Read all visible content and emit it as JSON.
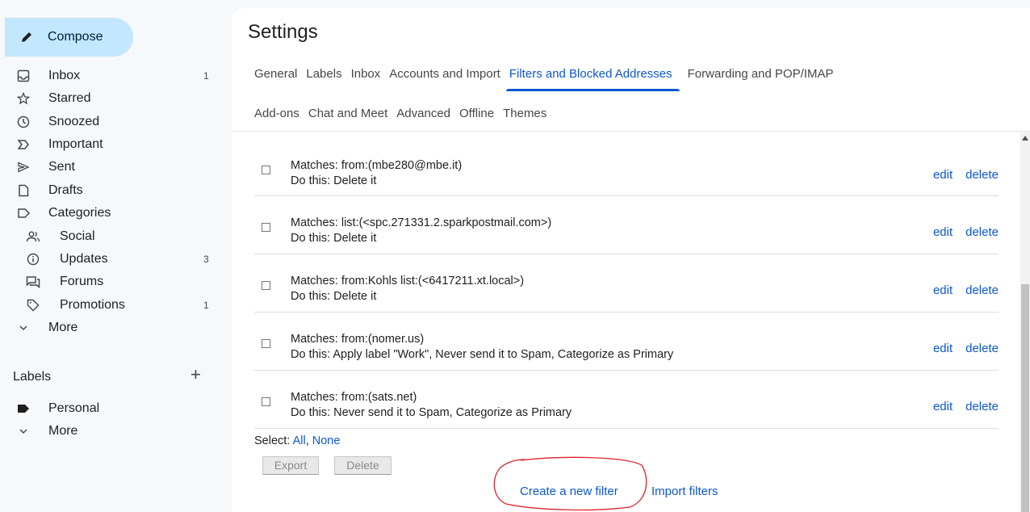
{
  "sidebar": {
    "compose_label": "Compose",
    "items": [
      {
        "label": "Inbox",
        "count": "1",
        "icon": "inbox-icon"
      },
      {
        "label": "Starred",
        "count": "",
        "icon": "star-icon"
      },
      {
        "label": "Snoozed",
        "count": "",
        "icon": "clock-icon"
      },
      {
        "label": "Important",
        "count": "",
        "icon": "important-icon"
      },
      {
        "label": "Sent",
        "count": "",
        "icon": "send-icon"
      },
      {
        "label": "Drafts",
        "count": "",
        "icon": "draft-icon"
      },
      {
        "label": "Categories",
        "count": "",
        "icon": "label-outline-icon"
      },
      {
        "label": "Social",
        "count": "",
        "icon": "people-icon"
      },
      {
        "label": "Updates",
        "count": "3",
        "icon": "info-icon"
      },
      {
        "label": "Forums",
        "count": "",
        "icon": "forum-icon"
      },
      {
        "label": "Promotions",
        "count": "1",
        "icon": "tag-icon"
      },
      {
        "label": "More",
        "count": "",
        "icon": "chevron-down-icon"
      }
    ],
    "labels_heading": "Labels",
    "labels_plus": "+",
    "label_items": [
      {
        "label": "Personal",
        "icon": "label-filled-icon"
      },
      {
        "label": "More",
        "icon": "chevron-down-icon"
      }
    ]
  },
  "settings": {
    "title": "Settings",
    "tabs_row1": [
      "General",
      "Labels",
      "Inbox",
      "Accounts and Import",
      "Filters and Blocked Addresses",
      "Forwarding and POP/IMAP"
    ],
    "tabs_row2": [
      "Add-ons",
      "Chat and Meet",
      "Advanced",
      "Offline",
      "Themes"
    ],
    "active_tab": "Filters and Blocked Addresses",
    "filters": [
      {
        "matches": "Matches: from:(mbe280@mbe.it)",
        "action": "Do this: Delete it"
      },
      {
        "matches": "Matches: list:(<spc.271331.2.sparkpostmail.com>)",
        "action": "Do this: Delete it"
      },
      {
        "matches": "Matches: from:Kohls list:(<6417211.xt.local>)",
        "action": "Do this: Delete it"
      },
      {
        "matches": "Matches: from:(nomer.us)",
        "action": "Do this: Apply label \"Work\", Never send it to Spam, Categorize as Primary"
      },
      {
        "matches": "Matches: from:(sats.net)",
        "action": "Do this: Never send it to Spam, Categorize as Primary"
      }
    ],
    "edit_label": "edit",
    "delete_label": "delete",
    "select_prefix": "Select: ",
    "select_all": "All",
    "select_sep": ", ",
    "select_none": "None",
    "export_button": "Export",
    "delete_button": "Delete",
    "create_filter": "Create a new filter",
    "import_filters": "Import filters"
  },
  "colors": {
    "accent": "#0b57d0",
    "compose_bg": "#c2e7ff",
    "annotation_circle": "#e0212a"
  }
}
